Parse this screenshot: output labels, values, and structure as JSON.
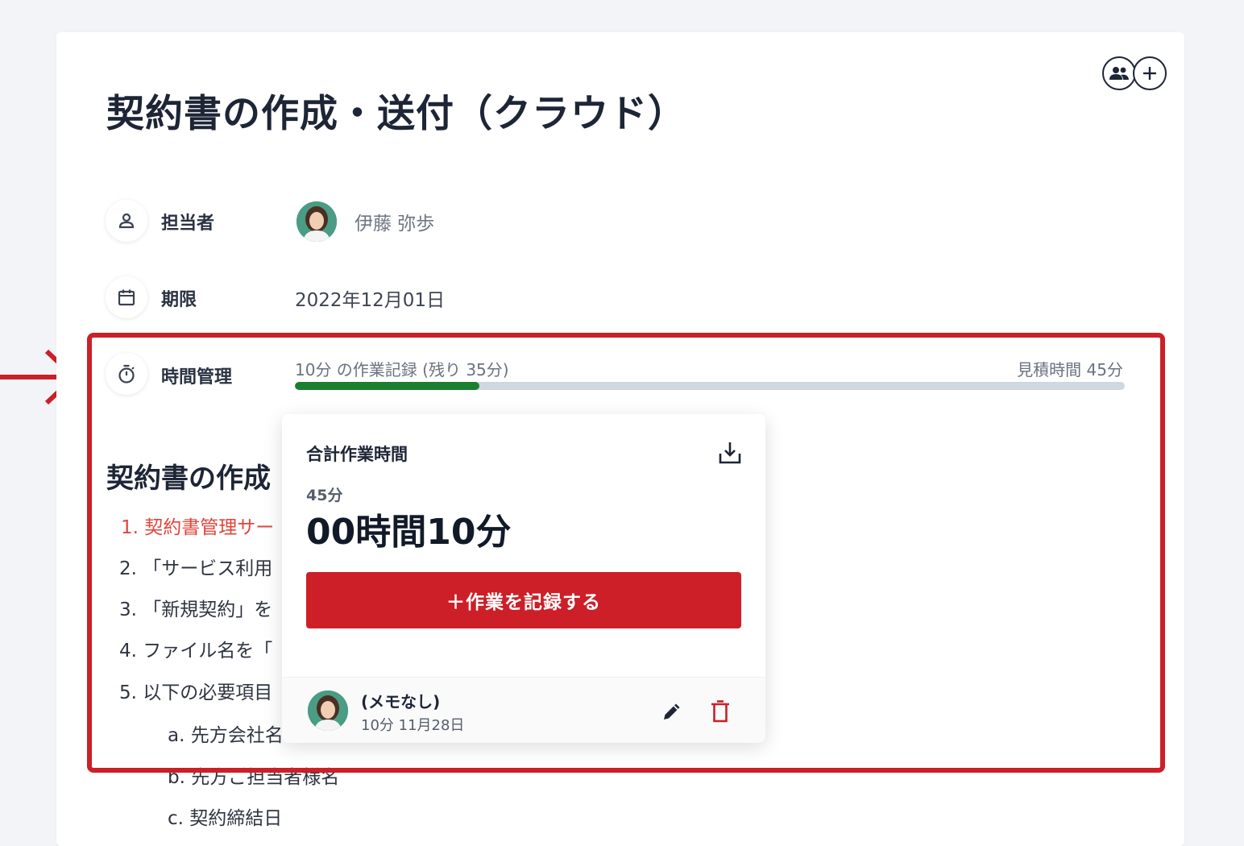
{
  "task": {
    "title": "契約書の作成・送付（クラウド）"
  },
  "fields": {
    "assignee_label": "担当者",
    "assignee_name": "伊藤 弥歩",
    "deadline_label": "期限",
    "deadline_value": "2022年12月01日",
    "time_label": "時間管理",
    "time_summary": "10分 の作業記録 (残り 35分)",
    "time_estimate": "見積時間 45分",
    "progress_fraction": 0.222
  },
  "description": {
    "heading": "契約書の作成",
    "steps": [
      "1. 契約書管理サー",
      "2. 「サービス利用",
      "3. 「新規契約」を",
      "4. ファイル名を「",
      "5. 以下の必要項目"
    ],
    "substeps": [
      "a. 先方会社名",
      "b. 先方ご担当者様名",
      "c. 契約締結日"
    ]
  },
  "popover": {
    "title": "合計作業時間",
    "estimate": "45分",
    "total": "00時間10分",
    "record_button": "＋作業を記録する",
    "entry": {
      "memo": "(メモなし)",
      "meta": "10分  11月28日"
    }
  },
  "colors": {
    "accent_red": "#cc1f27",
    "progress_green": "#1a7f2e",
    "progress_track": "#cfd7e0",
    "link_red": "#e2443b"
  },
  "icons": {
    "members": "group-icon",
    "add_member": "plus-icon",
    "assignee": "person-icon",
    "deadline": "calendar-icon",
    "time": "stopwatch-icon",
    "download": "download-icon",
    "edit": "pencil-icon",
    "delete": "trash-icon",
    "annotation": "arrow-right-icon"
  }
}
